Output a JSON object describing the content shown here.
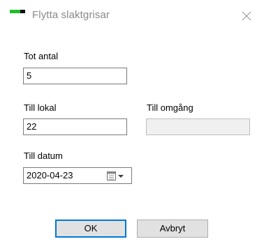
{
  "window": {
    "title": "Flytta slaktgrisar"
  },
  "form": {
    "tot_antal_label": "Tot antal",
    "tot_antal_value": "5",
    "till_lokal_label": "Till lokal",
    "till_lokal_value": "22",
    "till_omgang_label": "Till omgång",
    "till_omgang_value": "",
    "till_datum_label": "Till datum",
    "till_datum_value": "2020-04-23"
  },
  "buttons": {
    "ok_label": "OK",
    "cancel_label": "Avbryt"
  },
  "icons": {
    "app": "app-logo-icon",
    "close": "close-icon",
    "calendar": "calendar-icon",
    "dropdown": "chevron-down-icon"
  },
  "colors": {
    "accent": "#0078d7",
    "app_icon_green": "#1fbf2a"
  }
}
